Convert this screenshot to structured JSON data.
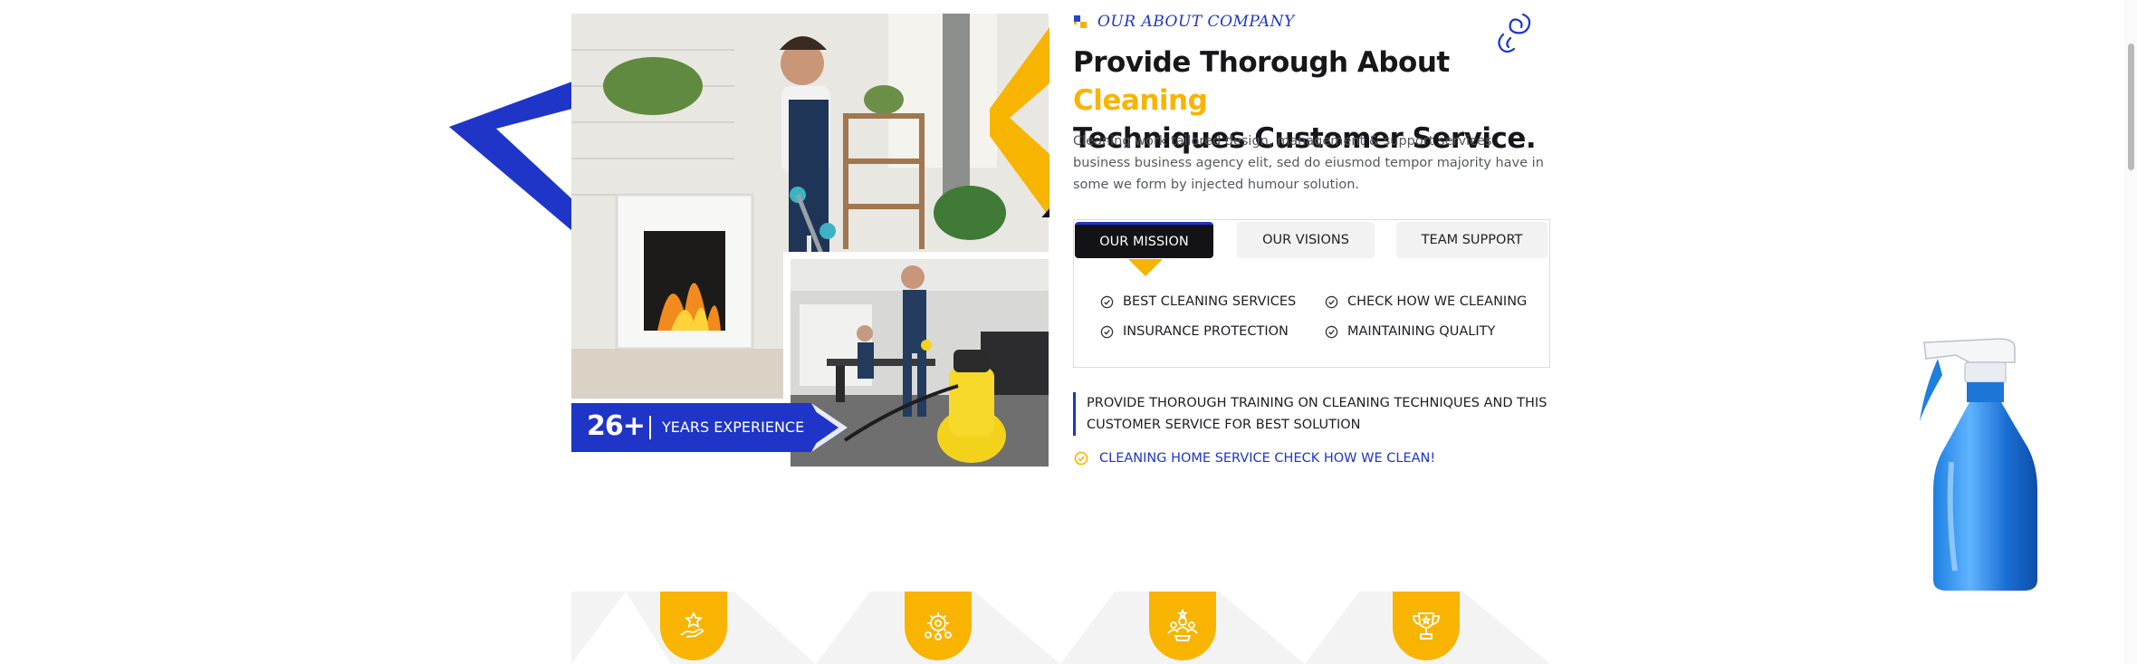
{
  "about": {
    "tag": "OUR ABOUT COMPANY",
    "heading_main": "Provide Thorough About",
    "heading_highlight": "Cleaning",
    "heading_rest": "Techniques Customer Service.",
    "intro": "Cleaning work tailored design, management & support services business business agency elit, sed do eiusmod tempor  majority have in some we form by injected humour solution."
  },
  "experience": {
    "number": "26+",
    "label": "YEARS EXPERIENCE"
  },
  "tabs": [
    {
      "label": "OUR MISSION",
      "active": true
    },
    {
      "label": "OUR VISIONS",
      "active": false
    },
    {
      "label": "TEAM SUPPORT",
      "active": false
    }
  ],
  "features": [
    "BEST CLEANING SERVICES",
    "CHECK HOW WE CLEANING",
    "INSURANCE PROTECTION",
    "MAINTAINING QUALITY"
  ],
  "quote": "PROVIDE THOROUGH TRAINING ON CLEANING TECHNIQUES AND THIS CUSTOMER SERVICE FOR BEST SOLUTION",
  "cta": "CLEANING HOME SERVICE CHECK HOW WE CLEAN!",
  "stats_icons": [
    "hand-star-icon",
    "gear-team-icon",
    "team-stars-icon",
    "trophy-icon"
  ],
  "colors": {
    "accent_yellow": "#f7b400",
    "accent_blue": "#1e35c8",
    "dark": "#121217"
  }
}
